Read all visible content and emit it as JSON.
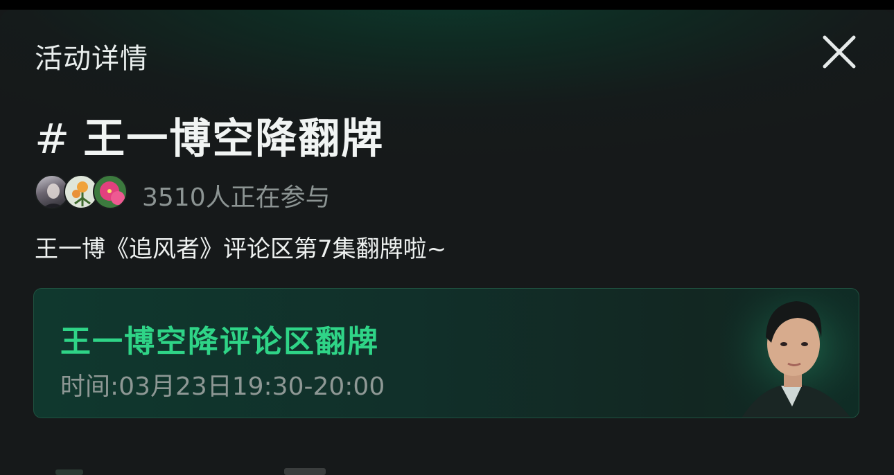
{
  "header": {
    "title": "活动详情",
    "close_icon": "close-icon"
  },
  "topic": {
    "hash": "#",
    "title": "王一博空降翻牌"
  },
  "participants": {
    "avatar_count": 3,
    "text": "3510人正在参与"
  },
  "description": "王一博《追风者》评论区第7集翻牌啦~",
  "event_card": {
    "title": "王一博空降评论区翻牌",
    "time": "时间:03月23日19:30-20:00"
  },
  "colors": {
    "accent_green": "#2fd487",
    "background": "#16191a",
    "card_border": "#1f5240"
  }
}
